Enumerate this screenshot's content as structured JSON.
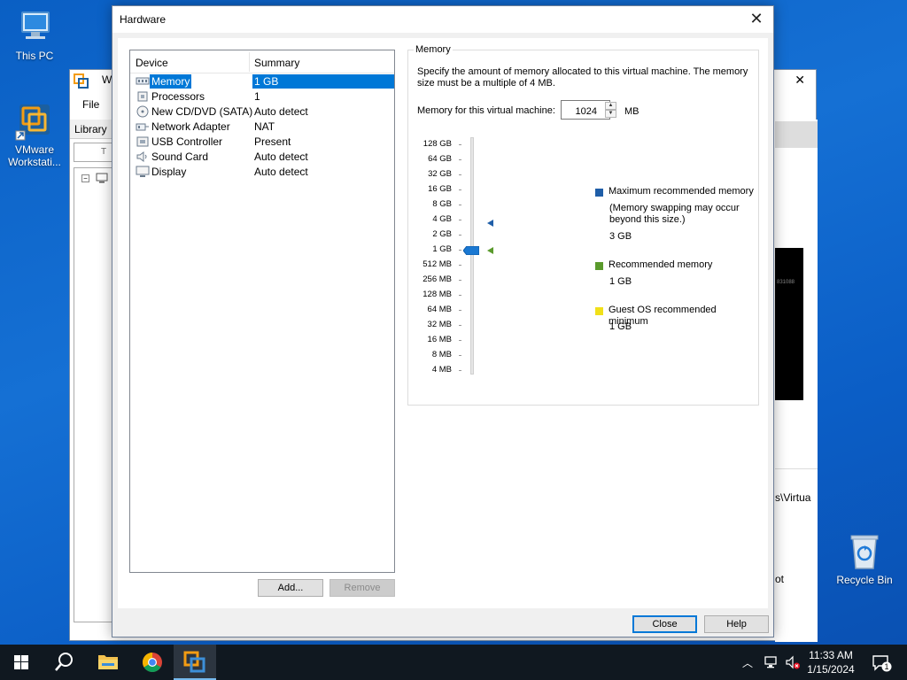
{
  "desktop": {
    "icons": [
      {
        "label": "This PC",
        "icon": "this-pc-icon"
      },
      {
        "label": "VMware\nWorkstati...",
        "icon": "vmware-icon"
      },
      {
        "label": "Recycle Bin",
        "icon": "recycle-bin-icon"
      }
    ]
  },
  "background_window": {
    "title": "W",
    "menu_file": "File",
    "library_label": "Library",
    "search_text": "T",
    "path_text": "s\\Virtua",
    "ot_text": "ot"
  },
  "dialog": {
    "title": "Hardware",
    "device_list": {
      "col_device": "Device",
      "col_summary": "Summary",
      "rows": [
        {
          "device": "Memory",
          "summary": "1 GB",
          "icon": "memory-icon",
          "selected": true
        },
        {
          "device": "Processors",
          "summary": "1",
          "icon": "processor-icon"
        },
        {
          "device": "New CD/DVD (SATA)",
          "summary": "Auto detect",
          "icon": "cd-dvd-icon"
        },
        {
          "device": "Network Adapter",
          "summary": "NAT",
          "icon": "network-adapter-icon"
        },
        {
          "device": "USB Controller",
          "summary": "Present",
          "icon": "usb-icon"
        },
        {
          "device": "Sound Card",
          "summary": "Auto detect",
          "icon": "sound-card-icon"
        },
        {
          "device": "Display",
          "summary": "Auto detect",
          "icon": "display-icon"
        }
      ]
    },
    "buttons": {
      "add": "Add...",
      "remove": "Remove",
      "close": "Close",
      "help": "Help"
    },
    "memory": {
      "group_title": "Memory",
      "description": "Specify the amount of memory allocated to this virtual machine. The memory size must be a multiple of 4 MB.",
      "field_label": "Memory for this virtual machine:",
      "value": "1024",
      "unit": "MB",
      "scale_labels": [
        "128 GB",
        "64 GB",
        "32 GB",
        "16 GB",
        "8 GB",
        "4 GB",
        "2 GB",
        "1 GB",
        "512 MB",
        "256 MB",
        "128 MB",
        "64 MB",
        "32 MB",
        "16 MB",
        "8 MB",
        "4 MB"
      ],
      "slider_value": "1 GB",
      "legend": {
        "max_label": "Maximum recommended memory",
        "max_note": "(Memory swapping may occur beyond this size.)",
        "max_value": "3 GB",
        "rec_label": "Recommended memory",
        "rec_value": "1 GB",
        "min_label": "Guest OS recommended minimum",
        "min_value": "1 GB"
      },
      "colors": {
        "max": "#1f5ea8",
        "recommended": "#5a9a2c",
        "minimum": "#f1e019"
      }
    }
  },
  "taskbar": {
    "time": "11:33 AM",
    "date": "1/15/2024",
    "notification_count": "1",
    "items": [
      "start-icon",
      "search-icon",
      "file-explorer-icon",
      "chrome-icon",
      "vmware-icon"
    ]
  }
}
